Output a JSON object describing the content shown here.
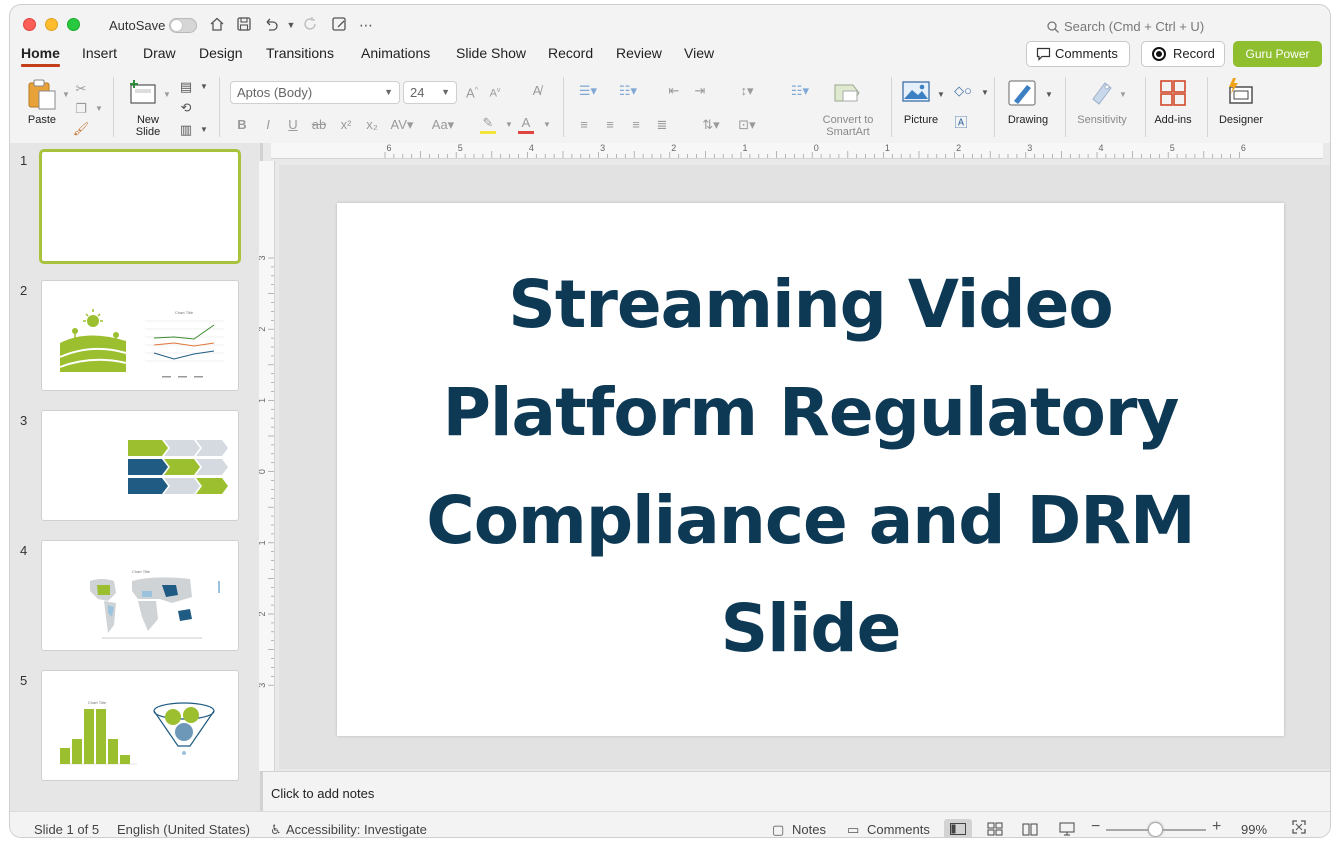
{
  "titlebar": {
    "autosave_label": "AutoSave",
    "search_placeholder": "Search (Cmd + Ctrl + U)"
  },
  "tabs": [
    "Home",
    "Insert",
    "Draw",
    "Design",
    "Transitions",
    "Animations",
    "Slide Show",
    "Record",
    "Review",
    "View"
  ],
  "active_tab": "Home",
  "actions": {
    "comments": "Comments",
    "record": "Record",
    "guru": "Guru Power"
  },
  "ribbon": {
    "paste": "Paste",
    "new_slide_1": "New",
    "new_slide_2": "Slide",
    "font_name": "Aptos (Body)",
    "font_size": "24",
    "convert_1": "Convert to",
    "convert_2": "SmartArt",
    "picture": "Picture",
    "drawing": "Drawing",
    "sensitivity": "Sensitivity",
    "addins": "Add-ins",
    "designer": "Designer"
  },
  "thumbnails": {
    "numbers": [
      "1",
      "2",
      "3",
      "4",
      "5"
    ],
    "chart_title": "Chart Title"
  },
  "ruler": {
    "horizontal": [
      "6",
      "5",
      "4",
      "3",
      "2",
      "1",
      "0",
      "1",
      "2",
      "3",
      "4",
      "5",
      "6"
    ],
    "vertical": [
      "3",
      "2",
      "1",
      "0",
      "1",
      "2",
      "3"
    ]
  },
  "slide": {
    "title": "Streaming Video Platform Regulatory Compliance and DRM Slide"
  },
  "notes_placeholder": "Click to add notes",
  "status": {
    "slide_position": "Slide 1 of 5",
    "language": "English (United States)",
    "accessibility": "Accessibility: Investigate",
    "notes": "Notes",
    "comments": "Comments",
    "zoom": "99%"
  },
  "colors": {
    "accent_tab": "#c43e1c",
    "guru_button": "#8fbe2f",
    "title_text": "#0d3955",
    "thumb_green": "#a8c23b",
    "thumb_navy": "#1f5b82"
  }
}
